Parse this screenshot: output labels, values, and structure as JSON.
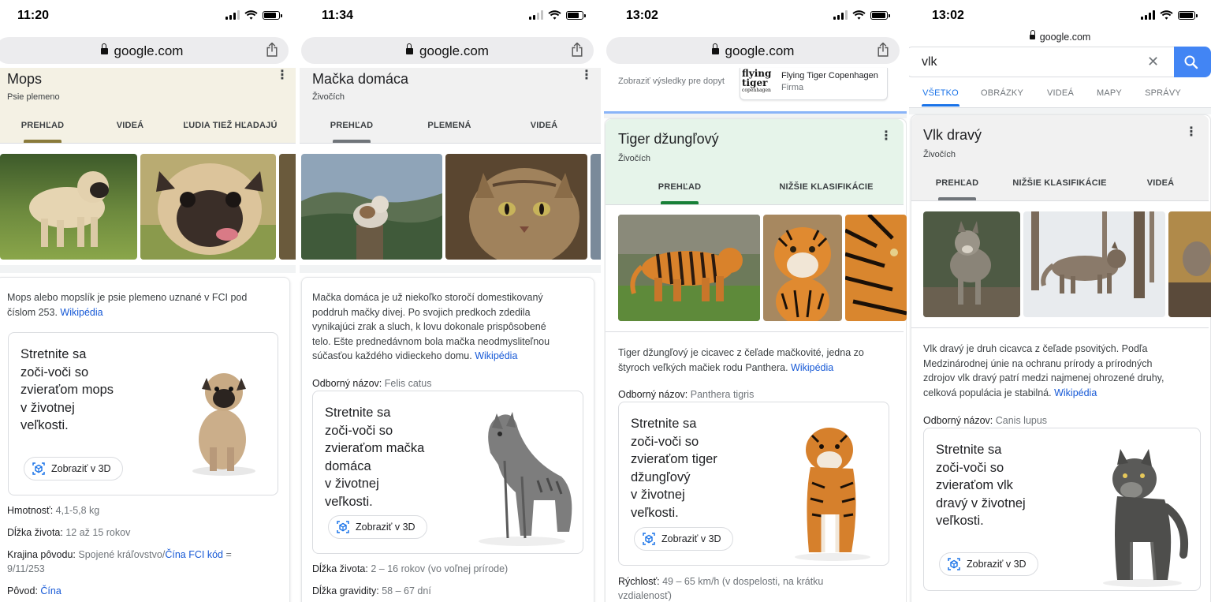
{
  "panels": [
    {
      "status": {
        "time": "11:20"
      },
      "browser": {
        "url": "google.com"
      },
      "kp": {
        "title": "Mops",
        "subtitle": "Psie plemeno",
        "tabs": [
          "PREHĽAD",
          "VIDEÁ",
          "ĽUDIA TIEŽ HĽADAJÚ"
        ],
        "description": "Mops alebo mopslík je psie plemeno uznané v FCI pod číslom 253.",
        "source": "Wikipédia",
        "meet_lines": [
          "Stretnite sa",
          "zoči-voči so",
          "zvieraťom mops",
          "v životnej",
          "veľkosti."
        ],
        "view3d": "Zobraziť v 3D",
        "facts": [
          {
            "label": "Hmotnosť:",
            "value": "4,1-5,8 kg"
          },
          {
            "label": "Dĺžka života:",
            "value": "12 až 15 rokov"
          },
          {
            "label": "Krajina pôvodu:",
            "value": "Spojené kráľovstvo/",
            "link": "Čína FCI kód",
            "tail": "=",
            "line2": "9/11/253"
          },
          {
            "label": "Pôvod:",
            "link": "Čína"
          }
        ]
      }
    },
    {
      "status": {
        "time": "11:34"
      },
      "browser": {
        "url": "google.com"
      },
      "kp": {
        "title": "Mačka domáca",
        "subtitle": "Živočích",
        "tabs": [
          "PREHĽAD",
          "PLEMENÁ",
          "VIDEÁ"
        ],
        "description_lines": [
          "Mačka domáca je už niekoľko storočí domestikovaný",
          "poddruh mačky divej. Po svojich predkoch zdedila",
          "vynikajúci zrak a sluch, k lovu dokonale prispôsobené",
          "telo. Ešte prednedávnom bola mačka neodmysliteľnou",
          "súčasťou každého vidieckeho domu."
        ],
        "source": "Wikipédia",
        "sci_label": "Odborný názov:",
        "sci_value": "Felis catus",
        "meet_lines": [
          "Stretnite sa",
          "zoči-voči so",
          "zvieraťom mačka",
          "domáca",
          "v životnej",
          "veľkosti."
        ],
        "view3d": "Zobraziť v 3D",
        "facts": [
          {
            "label": "Dĺžka života:",
            "value": "2 – 16 rokov (vo voľnej prírode)"
          },
          {
            "label": "Dĺžka gravidity:",
            "value": "58 – 67 dní"
          }
        ]
      }
    },
    {
      "status": {
        "time": "13:02"
      },
      "browser": {
        "url": "google.com"
      },
      "top_result": {
        "prefix": "Zobraziť výsledky pre dopyt",
        "logo_top": "flying",
        "logo_mid": "tiger",
        "logo_bottom": "copenhagen",
        "name": "Flying Tiger Copenhagen",
        "type": "Firma"
      },
      "kp": {
        "title": "Tiger džungľový",
        "subtitle": "Živočích",
        "tabs": [
          "PREHĽAD",
          "NIŽŠIE KLASIFIKÁCIE"
        ],
        "description_lines": [
          "Tiger džungľový je cicavec z čeľade mačkovité, jedna zo",
          "štyroch veľkých mačiek rodu Panthera."
        ],
        "source": "Wikipédia",
        "sci_label": "Odborný názov:",
        "sci_value": "Panthera tigris",
        "meet_lines": [
          "Stretnite sa",
          "zoči-voči so",
          "zvieraťom tiger",
          "džungľový",
          "v životnej",
          "veľkosti."
        ],
        "view3d": "Zobraziť v 3D",
        "facts": [
          {
            "label": "Rýchlosť:",
            "value": "49 – 65 km/h (v dospelosti, na krátku",
            "line2": "vzdialenosť)"
          }
        ]
      }
    },
    {
      "status": {
        "time": "13:02"
      },
      "browser": {
        "url": "google.com"
      },
      "search": {
        "query": "vlk",
        "tabs": [
          "VŠETKO",
          "OBRÁZKY",
          "VIDEÁ",
          "MAPY",
          "SPRÁVY"
        ]
      },
      "kp": {
        "title": "Vlk dravý",
        "subtitle": "Živočích",
        "tabs": [
          "PREHĽAD",
          "NIŽŠIE KLASIFIKÁCIE",
          "VIDEÁ"
        ],
        "description_lines": [
          "Vlk dravý je druh cicavca z čeľade psovitých. Podľa",
          "Medzinárodnej únie na ochranu prírody a prírodných",
          "zdrojov vlk dravý patrí medzi najmenej ohrozené druhy,",
          "celková populácia je stabilná."
        ],
        "source": "Wikipédia",
        "sci_label": "Odborný názov:",
        "sci_value": "Canis lupus",
        "meet_lines": [
          "Stretnite sa",
          "zoči-voči so",
          "zvieraťom vlk",
          "dravý v životnej",
          "veľkosti."
        ],
        "view3d": "Zobraziť v 3D"
      }
    }
  ],
  "colors": {
    "accent_blue": "#1a73e8",
    "link_blue": "#1558d6",
    "tab_gold": "#8a7a3a",
    "tab_green": "#188038"
  },
  "icons": [
    "lock-icon",
    "share-icon",
    "more-vert-icon",
    "cube-3d-icon",
    "close-icon",
    "search-icon",
    "signal-icon",
    "wifi-icon",
    "battery-icon"
  ]
}
